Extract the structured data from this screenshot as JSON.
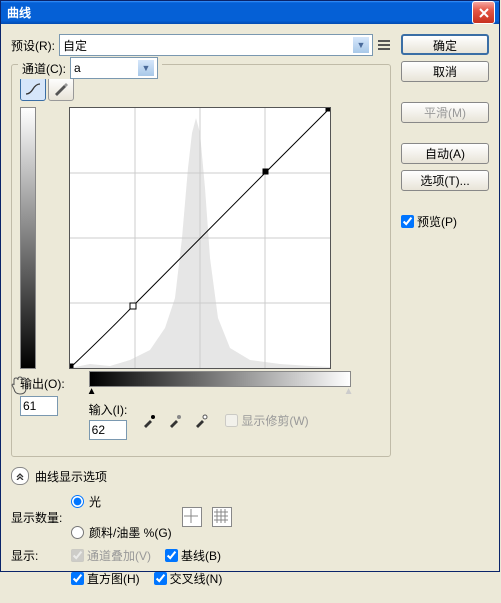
{
  "titlebar": {
    "title": "曲线"
  },
  "preset": {
    "label": "预设(R):",
    "value": "自定"
  },
  "buttons": {
    "ok": "确定",
    "cancel": "取消",
    "smooth": "平滑(M)",
    "auto": "自动(A)",
    "options": "选项(T)..."
  },
  "preview": {
    "label": "预览(P)",
    "checked": true
  },
  "channel": {
    "label": "通道(C):",
    "value": "a"
  },
  "output": {
    "label": "输出(O):",
    "value": "61"
  },
  "input": {
    "label": "输入(I):",
    "value": "62"
  },
  "showclip": {
    "label": "显示修剪(W)"
  },
  "expand": {
    "label": "曲线显示选项"
  },
  "amount": {
    "label": "显示数量:",
    "light": "光",
    "ink": "颜料/油墨 %(G)"
  },
  "show": {
    "label": "显示:",
    "overlay": "通道叠加(V)",
    "baseline": "基线(B)",
    "histogram": "直方图(H)",
    "intersect": "交叉线(N)"
  },
  "chart_data": {
    "type": "line",
    "xlabel": "输入",
    "ylabel": "输出",
    "xlim": [
      0,
      255
    ],
    "ylim": [
      0,
      255
    ],
    "points": [
      {
        "x": 0,
        "y": 0
      },
      {
        "x": 62,
        "y": 61
      },
      {
        "x": 192,
        "y": 192
      },
      {
        "x": 255,
        "y": 255
      }
    ]
  }
}
